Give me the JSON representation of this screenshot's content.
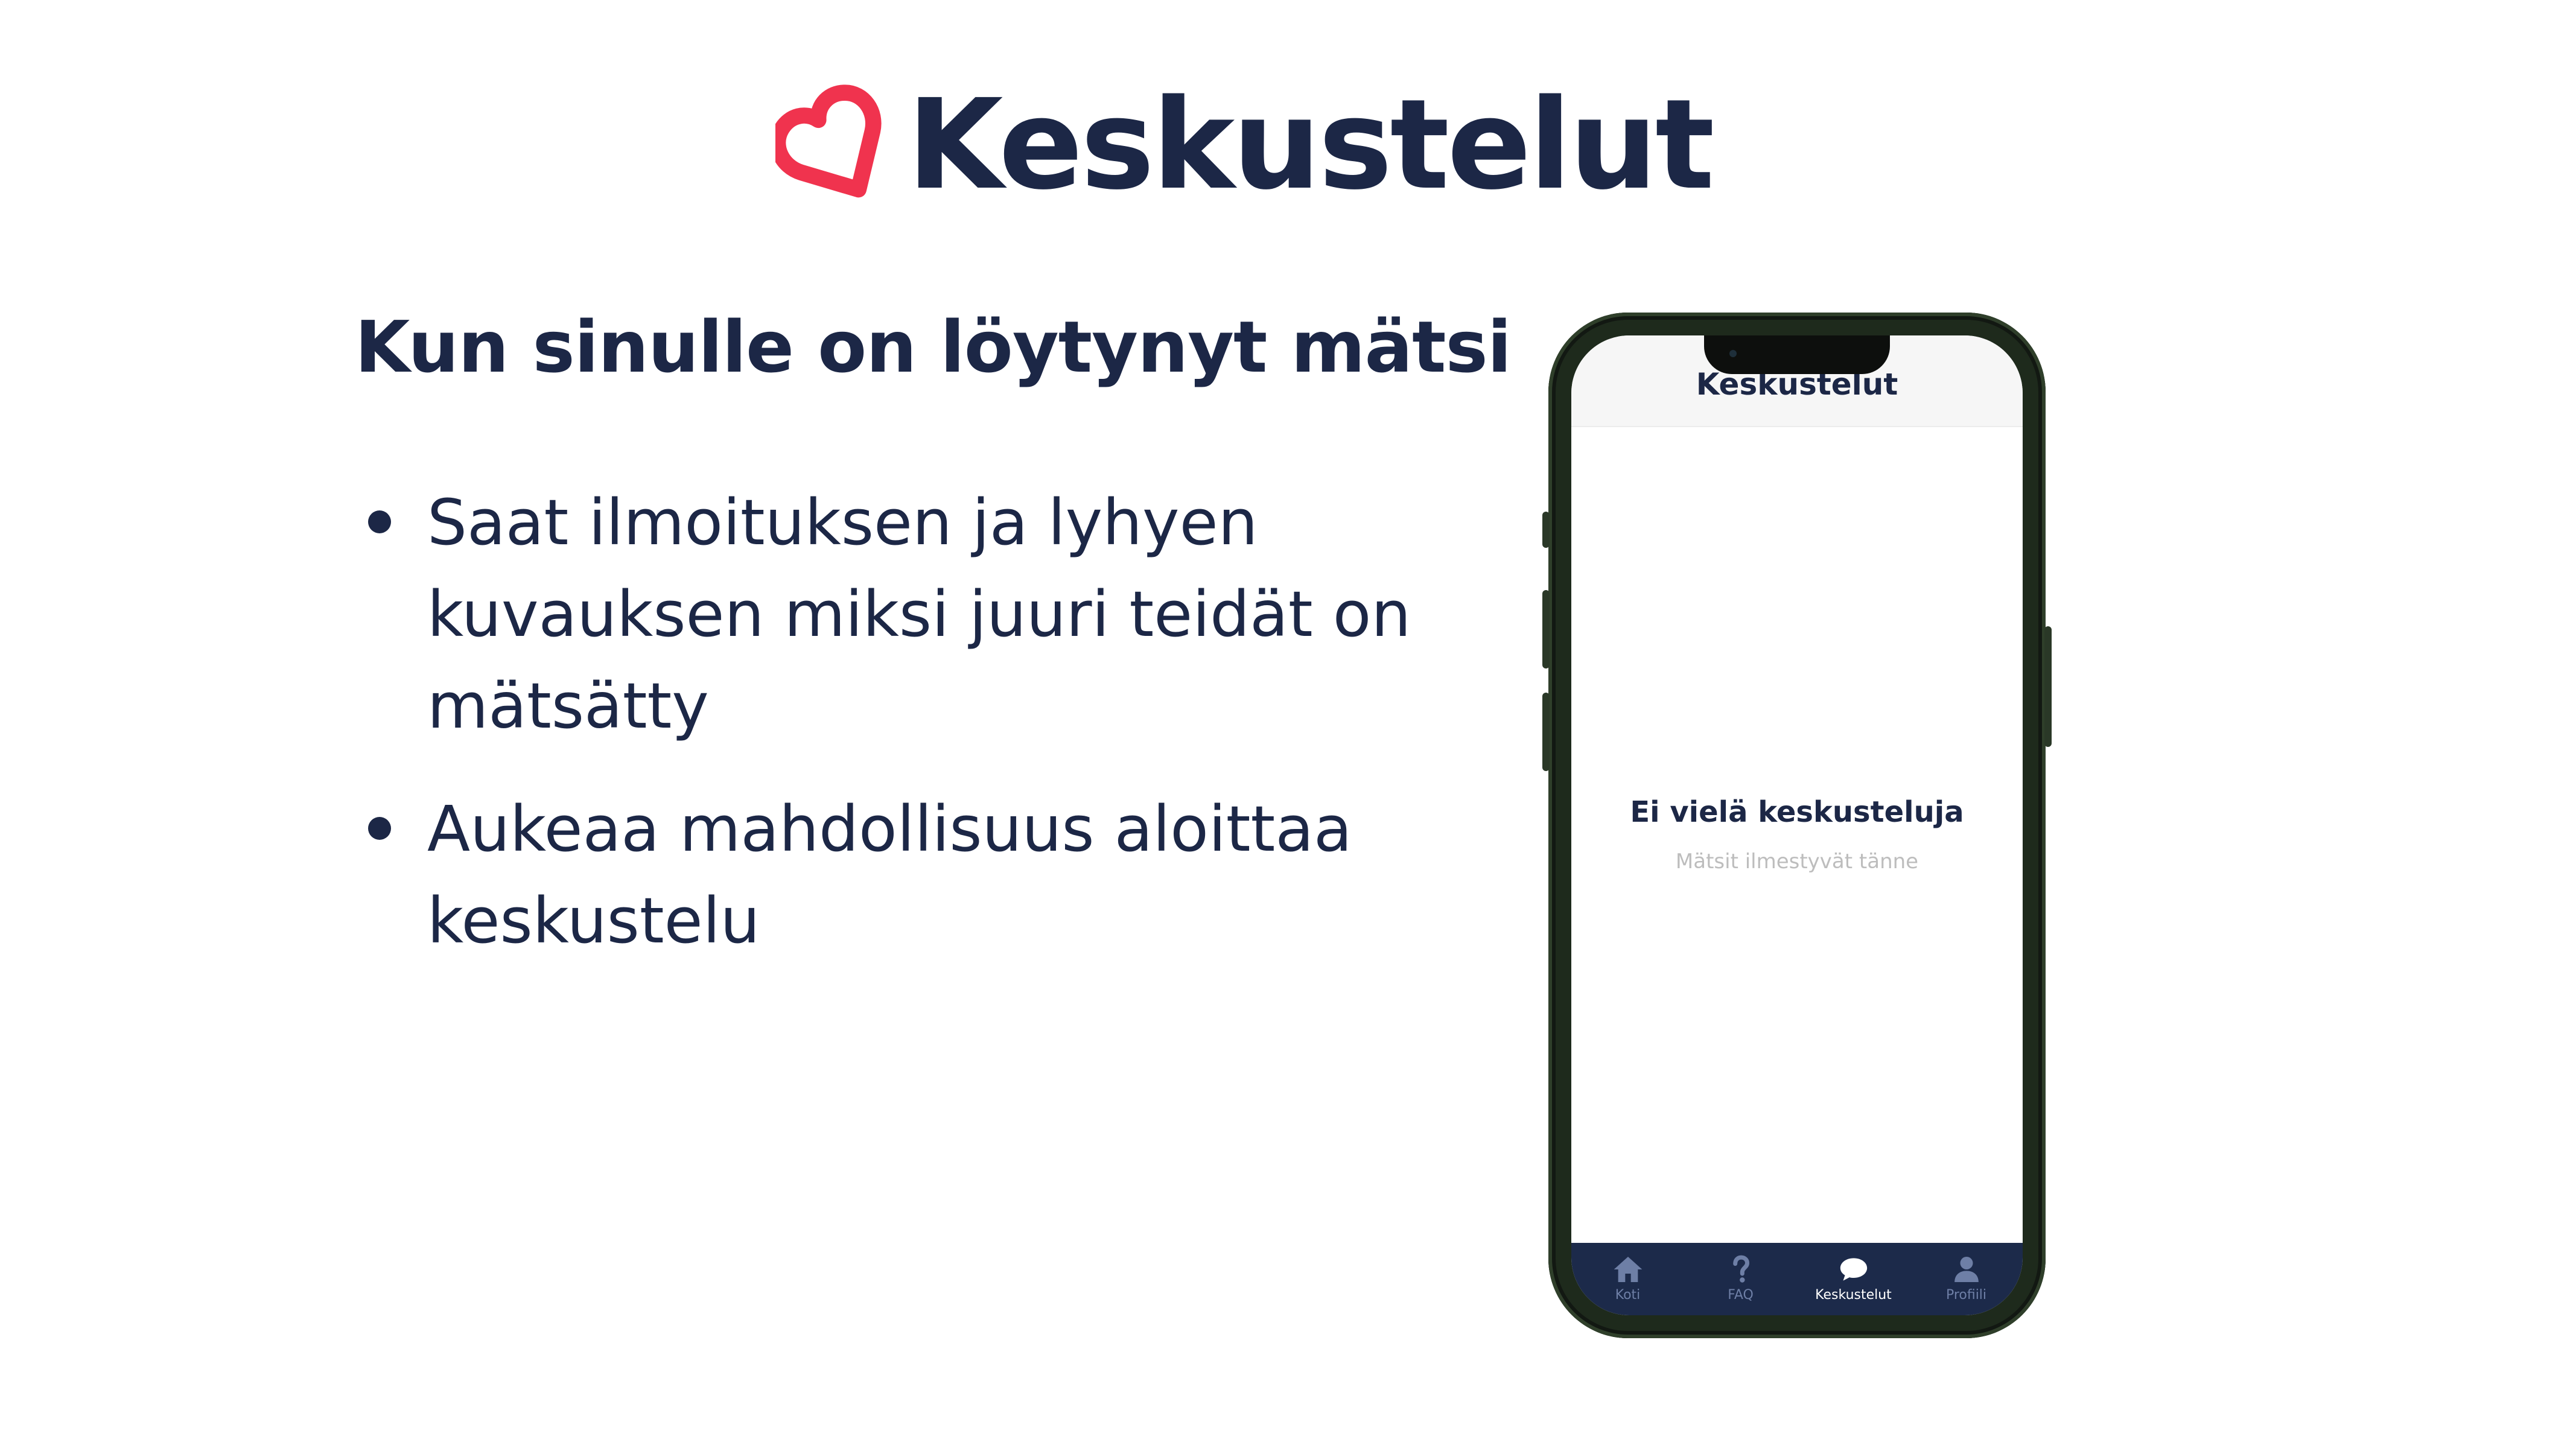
{
  "brand": {
    "title": "Keskustelut",
    "accent_color": "#f0334e",
    "text_color": "#1c2746",
    "logo_icon": "heart-outline-icon"
  },
  "content": {
    "headline": "Kun sinulle on löytynyt mätsi",
    "bullets": [
      "Saat ilmoituksen ja lyhyen kuvauksen miksi juuri teidät on mätsätty",
      "Aukeaa mahdollisuus aloittaa keskustelu"
    ]
  },
  "phone": {
    "header_title": "Keskustelut",
    "empty_title": "Ei vielä keskusteluja",
    "empty_subtitle": "Mätsit ilmestyvät tänne",
    "tabbar_color": "#1c2a4a",
    "tabs": [
      {
        "label": "Koti",
        "icon": "home-icon",
        "active": false
      },
      {
        "label": "FAQ",
        "icon": "question-icon",
        "active": false
      },
      {
        "label": "Keskustelut",
        "icon": "chat-bubble-icon",
        "active": true
      },
      {
        "label": "Profiili",
        "icon": "user-icon",
        "active": false
      }
    ]
  }
}
